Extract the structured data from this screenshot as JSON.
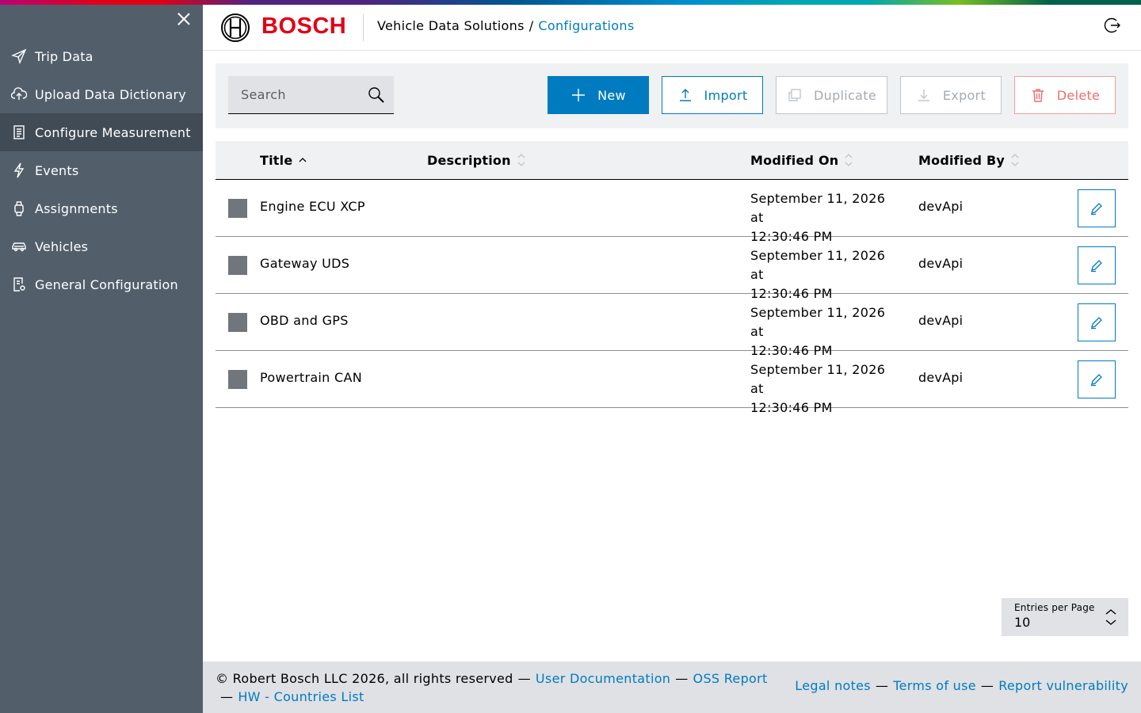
{
  "brand": {
    "name": "BOSCH",
    "logo_color": "#e20015"
  },
  "header": {
    "app_name": "Vehicle Data Solutions",
    "separator": "/",
    "current_page": "Configurations",
    "logout_icon": "logout-icon"
  },
  "sidebar": {
    "close_icon": "close-icon",
    "items": [
      {
        "label": "Trip Data",
        "icon": "send-icon",
        "active": false
      },
      {
        "label": "Upload Data Dictionary",
        "icon": "cloud-upload-icon",
        "active": false
      },
      {
        "label": "Configure Measurement",
        "icon": "document-list-icon",
        "active": true
      },
      {
        "label": "Events",
        "icon": "lightning-icon",
        "active": false
      },
      {
        "label": "Assignments",
        "icon": "watch-icon",
        "active": false
      },
      {
        "label": "Vehicles",
        "icon": "car-icon",
        "active": false
      },
      {
        "label": "General Configuration",
        "icon": "document-settings-icon",
        "active": false
      }
    ]
  },
  "toolbar": {
    "search_placeholder": "Search",
    "new_label": "New",
    "import_label": "Import",
    "duplicate_label": "Duplicate",
    "export_label": "Export",
    "delete_label": "Delete"
  },
  "table": {
    "columns": {
      "title": "Title",
      "description": "Description",
      "modified_on": "Modified On",
      "modified_by": "Modified By"
    },
    "sort": {
      "column": "title",
      "direction": "ascending"
    },
    "rows": [
      {
        "title": "Engine ECU XCP",
        "description": "",
        "modified_on_line1": "September 11, 2026 at",
        "modified_on_line2": "12:30:46 PM",
        "modified_by": "devApi"
      },
      {
        "title": "Gateway UDS",
        "description": "",
        "modified_on_line1": "September 11, 2026 at",
        "modified_on_line2": "12:30:46 PM",
        "modified_by": "devApi"
      },
      {
        "title": "OBD and GPS",
        "description": "",
        "modified_on_line1": "September 11, 2026 at",
        "modified_on_line2": "12:30:46 PM",
        "modified_by": "devApi"
      },
      {
        "title": "Powertrain CAN",
        "description": "",
        "modified_on_line1": "September 11, 2026 at",
        "modified_on_line2": "12:30:46 PM",
        "modified_by": "devApi"
      }
    ]
  },
  "pagination": {
    "entries_label": "Entries per Page",
    "entries_value": "10"
  },
  "footer": {
    "copyright": "© Robert Bosch LLC 2026, all rights reserved",
    "dash": "—",
    "user_docs": "User Documentation",
    "oss_report": "OSS Report",
    "hw_countries": "HW - Countries List",
    "legal_notes": "Legal notes",
    "terms": "Terms of use",
    "report_vuln": "Report vulnerability"
  },
  "colors": {
    "sidebar_bg": "#525f6b",
    "sidebar_active_bg": "#414b55",
    "primary": "#007bc0",
    "danger": "#ed6e6e",
    "toolbar_bg": "#eff1f2",
    "footer_bg": "#dfe1e4"
  }
}
